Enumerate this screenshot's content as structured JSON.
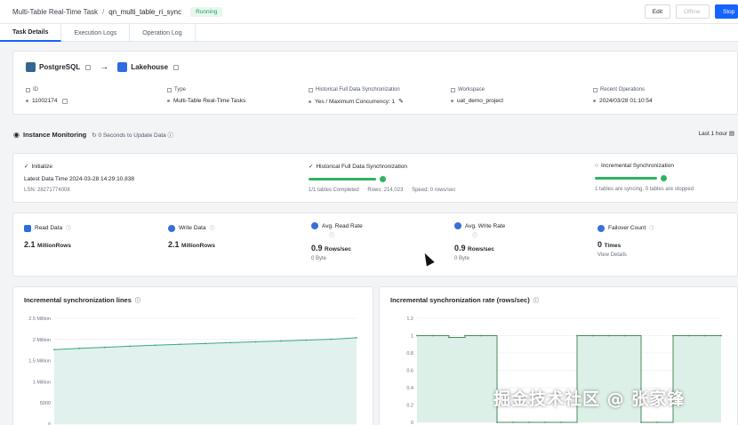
{
  "header": {
    "breadcrumb_root": "Multi-Table Real-Time Task",
    "separator": "/",
    "task_name": "qn_multi_table_ri_sync",
    "status": "Running",
    "edit_label": "Edit",
    "offline_label": "Offline",
    "stop_label": "Stop"
  },
  "tabs": [
    "Task Details",
    "Execution Logs",
    "Operation Log"
  ],
  "task": {
    "source": "PostgreSQL",
    "arrow": "→",
    "target": "Lakehouse",
    "fields": [
      {
        "label": "ID",
        "value": "11002174"
      },
      {
        "label": "Type",
        "value": "Multi-Table Real-Time Tasks"
      },
      {
        "label": "Historical Full Data Synchronization",
        "value": "Yes  /  Maximum Concurrency: 1"
      },
      {
        "label": "Workspace",
        "value": "uat_demo_project"
      },
      {
        "label": "Recent Operations",
        "value": "2024/03/28 01:10:54"
      }
    ]
  },
  "monitoring": {
    "title": "Instance Monitoring",
    "subtitle": "0 Seconds to Update Data",
    "range": "Last 1 hour",
    "stages": {
      "initialize": {
        "title": "Initialize",
        "data_time": "Latest Data Time  2024-03-28 14:29:10.838",
        "lsn": "LSN:  28271774008"
      },
      "full": {
        "title": "Historical Full Data Synchronization",
        "info": [
          "1/1 tables Completed",
          "Rows: 214,023",
          "Speed: 0 rows/sec"
        ],
        "progress": 1.0
      },
      "incremental": {
        "title": "Incremental Synchronization",
        "info": "1 tables are syncing, 0 tables are stopped",
        "progress": 1.0
      }
    }
  },
  "metrics": [
    {
      "label": "Read Data",
      "value": "2.1",
      "unit": "MillionRows",
      "sub": ""
    },
    {
      "label": "Write Data",
      "value": "2.1",
      "unit": "MillionRows",
      "sub": ""
    },
    {
      "label": "Avg. Read Rate",
      "value": "0.9",
      "unit": "Rows/sec",
      "sub": "0 Byte"
    },
    {
      "label": "Avg. Write Rate",
      "value": "0.9",
      "unit": "Rows/sec",
      "sub": "0 Byte"
    },
    {
      "label": "Failover Count",
      "value": "0",
      "unit": "Times",
      "sub": "View Details"
    }
  ],
  "chart_data": [
    {
      "type": "area",
      "title": "Incremental synchronization lines",
      "yticks": [
        "2.5 Million",
        "2 Million",
        "1.5 Million",
        "1 Million",
        "5000",
        "0"
      ],
      "ylim": [
        0,
        2500000
      ],
      "x": [
        0,
        1,
        2,
        3,
        4,
        5,
        6,
        7,
        8,
        9,
        10,
        11,
        12
      ],
      "values": [
        1760000,
        1790000,
        1815000,
        1840000,
        1865000,
        1885000,
        1905000,
        1925000,
        1945000,
        1965000,
        1985000,
        2005000,
        2040000
      ]
    },
    {
      "type": "area",
      "title": "Incremental synchronization rate (rows/sec)",
      "yticks": [
        "1.2",
        "1",
        "0.8",
        "0.6",
        "0.4",
        "0.2",
        "0"
      ],
      "ylim": [
        0,
        1.2
      ],
      "x": [
        0,
        1,
        2,
        3,
        4,
        5,
        6,
        7,
        8,
        9,
        10,
        11,
        12,
        13,
        14,
        15,
        16,
        17,
        18,
        19
      ],
      "values": [
        1,
        1,
        0.98,
        1,
        1,
        0,
        0,
        0,
        0,
        0,
        1,
        1,
        1,
        1,
        0,
        0,
        1,
        1,
        1,
        1
      ]
    }
  ],
  "watermark": "掘金技术社区 @ 张家锋"
}
